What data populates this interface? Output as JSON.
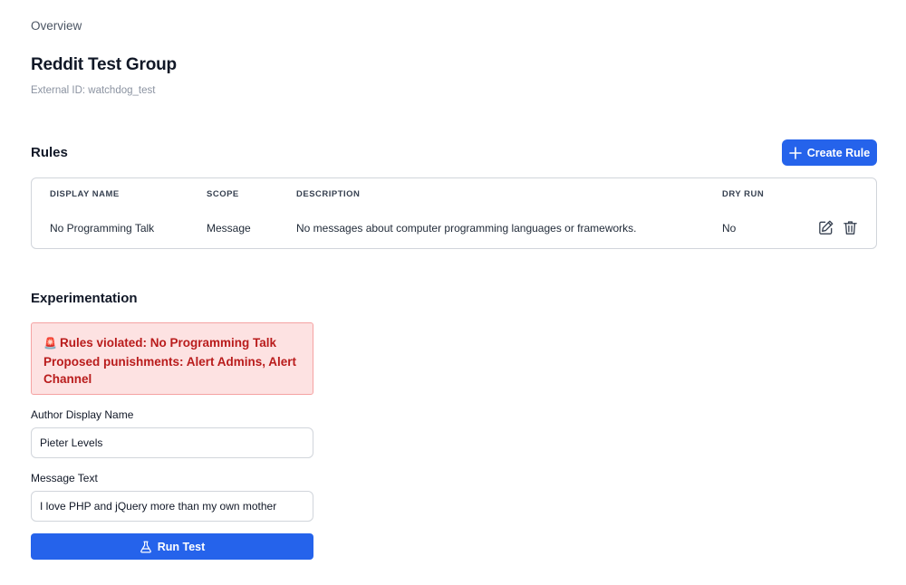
{
  "breadcrumb": {
    "label": "Overview"
  },
  "header": {
    "title": "Reddit Test Group",
    "external_id": "External ID: watchdog_test"
  },
  "rules": {
    "heading": "Rules",
    "create_label": "Create Rule",
    "columns": [
      "DISPLAY NAME",
      "SCOPE",
      "DESCRIPTION",
      "DRY RUN"
    ],
    "rows": [
      {
        "display_name": "No Programming Talk",
        "scope": "Message",
        "description": "No messages about computer programming languages or frameworks.",
        "dry_run": "No"
      }
    ]
  },
  "experimentation": {
    "heading": "Experimentation",
    "alert_line1": "Rules violated: No Programming Talk",
    "alert_line2": "Proposed punishments: Alert Admins, Alert Channel",
    "author_label": "Author Display Name",
    "author_value": "Pieter Levels",
    "message_label": "Message Text",
    "message_value": "I love PHP and jQuery more than my own mother",
    "run_label": "Run Test"
  },
  "icons": {
    "create": "plus-icon",
    "edit": "edit-icon",
    "delete": "trash-icon",
    "alert": "siren-icon",
    "run": "flask-icon"
  },
  "colors": {
    "accent": "#2563eb",
    "alert_bg": "#fde2e2",
    "alert_border": "#f5a3a3",
    "alert_text": "#b91c1c"
  }
}
